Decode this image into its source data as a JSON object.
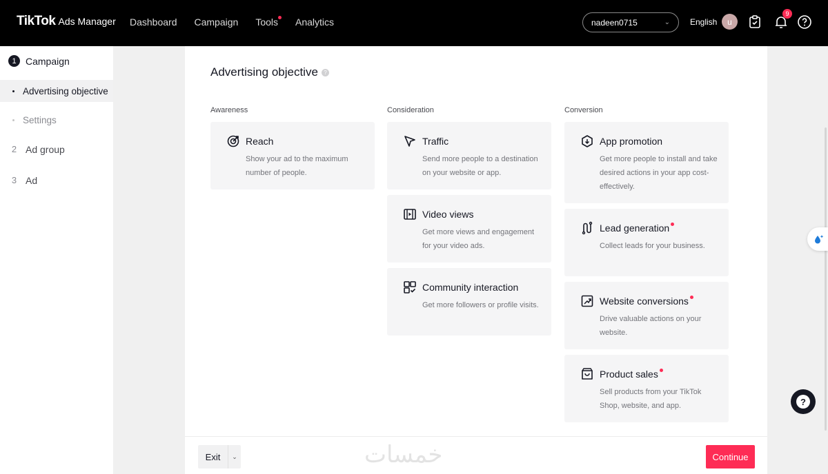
{
  "header": {
    "brand": "TikTok",
    "brand_sub": "Ads Manager",
    "nav": [
      {
        "label": "Dashboard"
      },
      {
        "label": "Campaign"
      },
      {
        "label": "Tools"
      },
      {
        "label": "Analytics"
      }
    ],
    "account": "nadeen0715",
    "language": "English",
    "avatar_initial": "u",
    "notification_count": "9",
    "accent_color": "#fe2c55"
  },
  "sidebar": {
    "steps": [
      {
        "number": "1",
        "label": "Campaign"
      },
      {
        "number": "2",
        "label": "Ad group"
      },
      {
        "number": "3",
        "label": "Ad"
      }
    ],
    "sub_items": [
      {
        "label": "Advertising objective"
      },
      {
        "label": "Settings"
      }
    ]
  },
  "main": {
    "title": "Advertising objective",
    "help_glyph": "?",
    "columns": [
      {
        "label": "Awareness",
        "cards": [
          {
            "title": "Reach",
            "description": "Show your ad to the maximum number of people.",
            "icon": "reach-icon"
          }
        ]
      },
      {
        "label": "Consideration",
        "cards": [
          {
            "title": "Traffic",
            "description": "Send more people to a destination on your website or app.",
            "icon": "cursor-icon"
          },
          {
            "title": "Video views",
            "description": "Get more views and engagement for your video ads.",
            "icon": "video-icon"
          },
          {
            "title": "Community interaction",
            "description": "Get more followers or profile visits.",
            "icon": "community-icon"
          }
        ]
      },
      {
        "label": "Conversion",
        "cards": [
          {
            "title": "App promotion",
            "description": "Get more people to install and take desired actions in your app cost-effectively.",
            "icon": "app-icon"
          },
          {
            "title": "Lead generation",
            "description": "Collect leads for your business.",
            "icon": "lead-icon"
          },
          {
            "title": "Website conversions",
            "description": "Drive valuable actions on your website.",
            "icon": "chart-up-icon"
          },
          {
            "title": "Product sales",
            "description": "Sell products from your TikTok Shop, website, and app.",
            "icon": "bag-icon"
          }
        ]
      }
    ]
  },
  "footer": {
    "exit_label": "Exit",
    "continue_label": "Continue",
    "watermark": "خمسات"
  }
}
